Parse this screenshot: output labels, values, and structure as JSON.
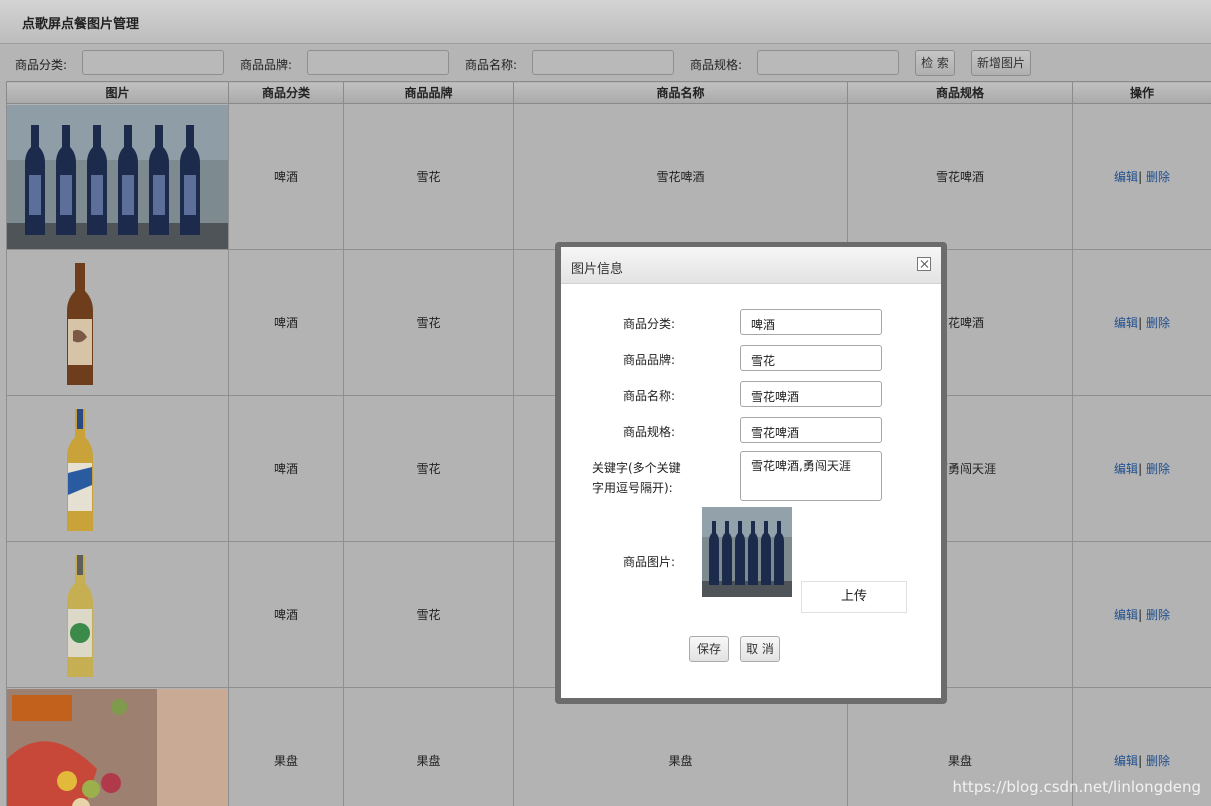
{
  "page": {
    "title": "点歌屏点餐图片管理"
  },
  "search": {
    "category_label": "商品分类:",
    "brand_label": "商品品牌:",
    "name_label": "商品名称:",
    "spec_label": "商品规格:",
    "search_button": "检 索",
    "add_button": "新增图片"
  },
  "table": {
    "headers": [
      "图片",
      "商品分类",
      "商品品牌",
      "商品名称",
      "商品规格",
      "操作"
    ],
    "edit_label": "编辑",
    "separator": "|",
    "delete_label": "删除",
    "rows": [
      {
        "category": "啤酒",
        "brand": "雪花",
        "name": "雪花啤酒",
        "spec": "雪花啤酒"
      },
      {
        "category": "啤酒",
        "brand": "雪花",
        "name": "",
        "spec": "雪花啤酒"
      },
      {
        "category": "啤酒",
        "brand": "雪花",
        "name": "",
        "spec": "啤酒勇闯天涯"
      },
      {
        "category": "啤酒",
        "brand": "雪花",
        "name": "",
        "spec": ""
      },
      {
        "category": "果盘",
        "brand": "果盘",
        "name": "果盘",
        "spec": "果盘"
      }
    ]
  },
  "dialog": {
    "title": "图片信息",
    "category_label": "商品分类:",
    "category_value": "啤酒",
    "brand_label": "商品品牌:",
    "brand_value": "雪花",
    "name_label": "商品名称:",
    "name_value": "雪花啤酒",
    "spec_label": "商品规格:",
    "spec_value": "雪花啤酒",
    "keywords_label_line1": "关键字(多个关键",
    "keywords_label_line2": "字用逗号隔开):",
    "keywords_value": "雪花啤酒,勇闯天涯",
    "image_label": "商品图片:",
    "upload_button": "上传",
    "save_button": "保存",
    "cancel_button": "取 消"
  },
  "watermark": "https://blog.csdn.net/linlongdeng",
  "colors": {
    "link": "#1f4f8f",
    "overlay_background": "#b3b3b3",
    "dialog_frame": "#6c6c6c"
  }
}
